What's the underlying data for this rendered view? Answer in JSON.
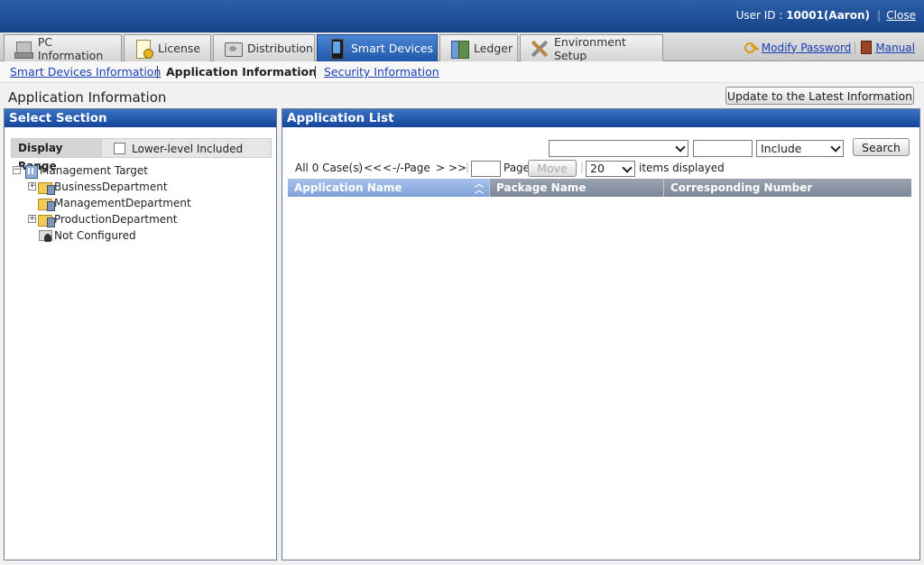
{
  "header": {
    "user_prefix": "User ID : ",
    "user_value": "10001(Aaron)",
    "close_label": "Close",
    "brand_color": "#1b4b95"
  },
  "tabs": [
    {
      "label": "PC Information",
      "icon": "pc-icon"
    },
    {
      "label": "License",
      "icon": "license-icon"
    },
    {
      "label": "Distribution",
      "icon": "distribution-icon"
    },
    {
      "label": "Smart Devices",
      "icon": "smart-device-icon",
      "active": true
    },
    {
      "label": "Ledger",
      "icon": "ledger-icon"
    },
    {
      "label": "Environment Setup",
      "icon": "tools-icon"
    }
  ],
  "top_links": {
    "modify_password": "Modify Password",
    "manual": "Manual"
  },
  "subnav": {
    "smart_devices_info": "Smart Devices Information",
    "application_info": "Application Information",
    "security_info": "Security Information"
  },
  "page": {
    "title": "Application Information",
    "update_button": "Update to the Latest Information"
  },
  "left_panel": {
    "title": "Select Section",
    "display_range_label": "Display Range",
    "lower_level_label": "Lower-level Included",
    "lower_level_checked": false,
    "tree": {
      "root": "Management Target",
      "children": [
        {
          "label": "BusinessDepartment",
          "expandable": true
        },
        {
          "label": "ManagementDepartment",
          "expandable": false
        },
        {
          "label": "ProductionDepartment",
          "expandable": true
        },
        {
          "label": "Not Configured",
          "expandable": false
        }
      ]
    }
  },
  "right_panel": {
    "title": "Application List",
    "filter": {
      "field_value": "",
      "keyword_value": "",
      "match_value": "Include",
      "search_label": "Search"
    },
    "pager": {
      "count_text": "All 0 Case(s)",
      "first": "<<",
      "prev": "<",
      "page_text": "-/-Page",
      "next": ">",
      "last": ">>",
      "page_input_value": "",
      "page_label": "Page",
      "move_label": "Move",
      "per_page_value": "20",
      "items_displayed": "items displayed"
    },
    "columns": [
      "Application Name",
      "Package Name",
      "Corresponding Number"
    ],
    "rows": []
  }
}
